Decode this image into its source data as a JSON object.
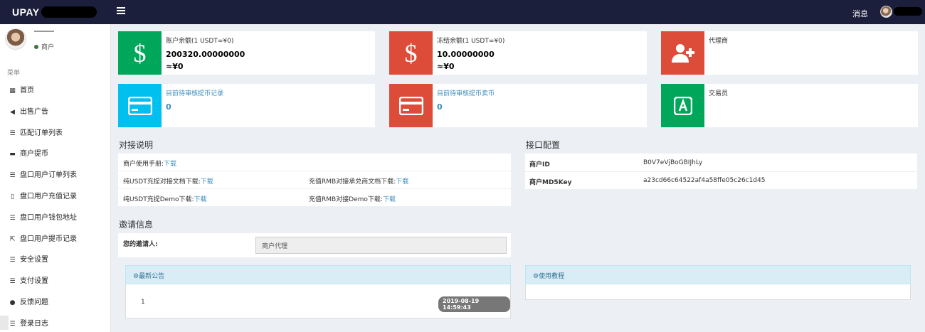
{
  "app": {
    "logo": "UPAY",
    "message_label": "消息"
  },
  "sidebar": {
    "status": "商户",
    "menu_header": "菜单",
    "items": [
      {
        "icon": "bar-chart-icon",
        "glyph": "▦",
        "label": "首页"
      },
      {
        "icon": "bullhorn-icon",
        "glyph": "◀",
        "label": "出售广告"
      },
      {
        "icon": "list-icon",
        "glyph": "☰",
        "label": "匹配订单列表"
      },
      {
        "icon": "credit-card-icon",
        "glyph": "▬",
        "label": "商户提币"
      },
      {
        "icon": "list-icon",
        "glyph": "☰",
        "label": "盘口用户订单列表"
      },
      {
        "icon": "clipboard-icon",
        "glyph": "▯",
        "label": "盘口用户充值记录"
      },
      {
        "icon": "list-icon",
        "glyph": "☰",
        "label": "盘口用户钱包地址"
      },
      {
        "icon": "external-link-icon",
        "glyph": "⇱",
        "label": "盘口用户提币记录"
      },
      {
        "icon": "list-icon",
        "glyph": "☰",
        "label": "安全设置"
      },
      {
        "icon": "list-icon",
        "glyph": "☰",
        "label": "支付设置"
      },
      {
        "icon": "comment-icon",
        "glyph": "●",
        "label": "反馈问题"
      },
      {
        "icon": "list-ul-icon",
        "glyph": "☰",
        "label": "登录日志"
      }
    ]
  },
  "cards": {
    "balance": {
      "title": "账户余额(1 USDT=¥0)",
      "value": "200320.00000000",
      "approx": "≈¥0"
    },
    "frozen": {
      "title": "冻结余额(1 USDT=¥0)",
      "value": "10.00000000",
      "approx": "≈¥0"
    },
    "agent": {
      "title": "代理商"
    },
    "pending_withdraw": {
      "title": "目前待审核提币记录",
      "value": "0"
    },
    "pending_sell": {
      "title": "目前待审核提币卖币",
      "value": "0"
    },
    "trader": {
      "title": "交易员"
    }
  },
  "integration": {
    "title": "对接说明",
    "manual_label": "商户使用手册:",
    "download": "下载",
    "usdt_doc": "纯USDT充提对接文档下载:",
    "rmb_doc": "充值RMB对接承兑商文档下载:",
    "usdt_demo": "纯USDT充提Demo下载:",
    "rmb_demo": "充值RMB对接Demo下载:"
  },
  "api": {
    "title": "接口配置",
    "id_label": "商户ID",
    "id_value": "B0V7eVjBoGBIJhLy",
    "key_label": "商户MD5Key",
    "key_value": "a23cd66c64522af4a58ffe05c26c1d45"
  },
  "invite": {
    "title": "邀请信息",
    "inviter_label": "您的邀请人:",
    "inviter_value": "商户代理"
  },
  "notice": {
    "title": "最新公告",
    "row_text": "1",
    "row_date": "2019-08-19 14:59:43"
  },
  "tutorial": {
    "title": "使用教程"
  },
  "colors": {
    "topbar": "#1b1f3b",
    "green": "#00a65a",
    "red": "#dd4b39",
    "aqua": "#00c0ef",
    "link": "#3c8dbc"
  }
}
